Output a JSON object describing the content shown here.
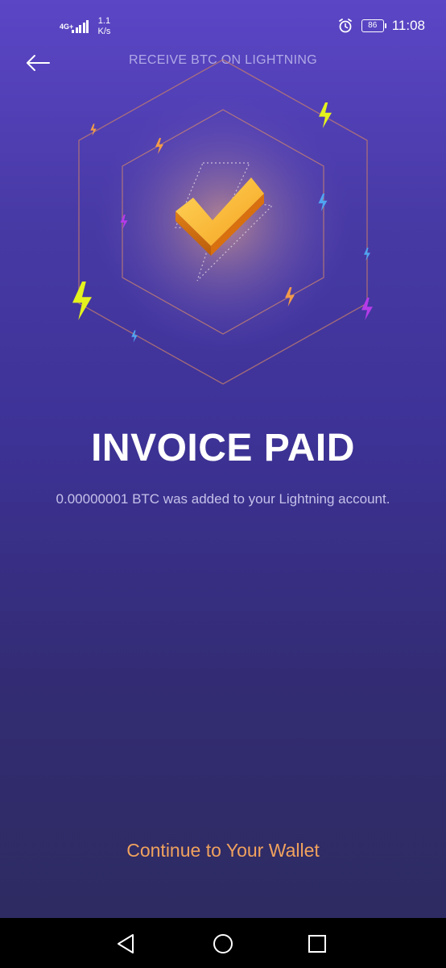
{
  "status_bar": {
    "network_type": "4G+",
    "network_speed_value": "1.1",
    "network_speed_unit": "K/s",
    "battery_level": "86",
    "time": "11:08",
    "icons": [
      "signal-icon",
      "alarm-icon",
      "battery-icon"
    ]
  },
  "header": {
    "title": "RECEIVE BTC ON LIGHTNING",
    "back_icon": "arrow-left-icon"
  },
  "hero": {
    "icon": "checkmark-icon",
    "decorations": "lightning-bolt-icon"
  },
  "result": {
    "title": "INVOICE PAID",
    "message": "0.00000001 BTC was added to your Lightning account."
  },
  "actions": {
    "continue_label": "Continue to Your Wallet"
  },
  "system_nav": {
    "icons": [
      "nav-back-icon",
      "nav-home-icon",
      "nav-recents-icon"
    ]
  },
  "colors": {
    "background_top": "#5b46c6",
    "background_bottom": "#2c2b5e",
    "accent": "#f0a25e",
    "checkmark": "#f6a623",
    "title_text": "#ffffff",
    "subtitle_text": "#c6c1ea",
    "header_text": "#b0a9e6",
    "bolt_yellow": "#e4f21d",
    "bolt_orange": "#f19a4a",
    "bolt_purple": "#b53be8",
    "bolt_blue": "#4fa4f2"
  }
}
